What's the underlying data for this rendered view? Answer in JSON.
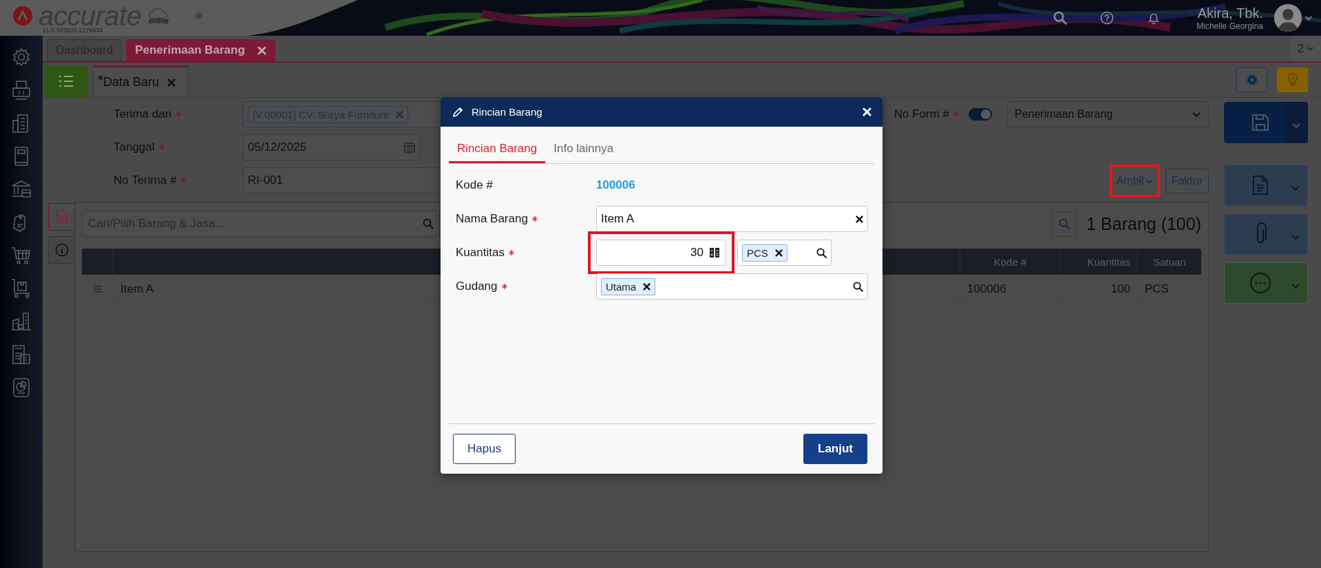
{
  "app": {
    "logo_text": "accurate",
    "logo_subtext": "online",
    "version": "v1.0.1#3502-2276934"
  },
  "header": {
    "user_name": "Akira, Tbk.",
    "user_subtitle": "Michelle Georgina"
  },
  "tabs": [
    {
      "label": "Dashboard",
      "selected": false,
      "closable": false
    },
    {
      "label": "Penerimaan Barang",
      "selected": true,
      "closable": true
    }
  ],
  "tab_count": "2",
  "subtabs": [
    {
      "label": "Data Baru",
      "modified": true,
      "selected": true
    }
  ],
  "form": {
    "fields": [
      {
        "label": "Terima dari",
        "required": true,
        "kind": "tag",
        "value": "[V.00001] CV. Surya Furniture"
      },
      {
        "label": "Tanggal",
        "required": true,
        "kind": "date",
        "value": "05/12/2025"
      },
      {
        "label": "No Terima #",
        "required": true,
        "kind": "text",
        "value": "RI-001"
      }
    ],
    "no_form": {
      "label": "No Form #",
      "required": true,
      "on": true
    },
    "form_type": "Penerimaan Barang",
    "buttons": [
      {
        "label": "Ambil",
        "kind": "dropdown",
        "highlighted": true
      },
      {
        "label": "Faktur",
        "kind": "plain",
        "highlighted": false
      }
    ]
  },
  "detail": {
    "side_tabs": [
      {
        "kind": "document",
        "selected": true
      },
      {
        "kind": "info",
        "selected": false
      }
    ],
    "search": {
      "placeholder": "Cari/Pilih Barang & Jasa..."
    },
    "summary": "1 Barang (100)",
    "table": {
      "columns": [
        "Kode #",
        "Kuantitas",
        "Satuan"
      ],
      "rows": [
        {
          "name": "Item A",
          "code": "100006",
          "quantity": "100",
          "unit": "PCS"
        }
      ]
    }
  },
  "dialog": {
    "title": "Rincian Barang",
    "tabs": [
      {
        "label": "Rincian Barang",
        "selected": true
      },
      {
        "label": "Info lainnya",
        "selected": false
      }
    ],
    "fields": [
      {
        "label": "Kode #",
        "kind": "static",
        "value": "100006",
        "required": false,
        "highlighted": false
      },
      {
        "label": "Nama Barang",
        "kind": "clearable",
        "value": "Item A",
        "required": true,
        "highlighted": false
      },
      {
        "label": "Kuantitas",
        "kind": "quantity",
        "value": "30",
        "unit": "PCS",
        "required": true,
        "highlighted": true
      },
      {
        "label": "Gudang",
        "kind": "tag",
        "value": "Utama",
        "required": true,
        "highlighted": false
      }
    ],
    "buttons": [
      {
        "label": "Hapus",
        "kind": "secondary"
      },
      {
        "label": "Lanjut",
        "kind": "primary"
      }
    ]
  }
}
